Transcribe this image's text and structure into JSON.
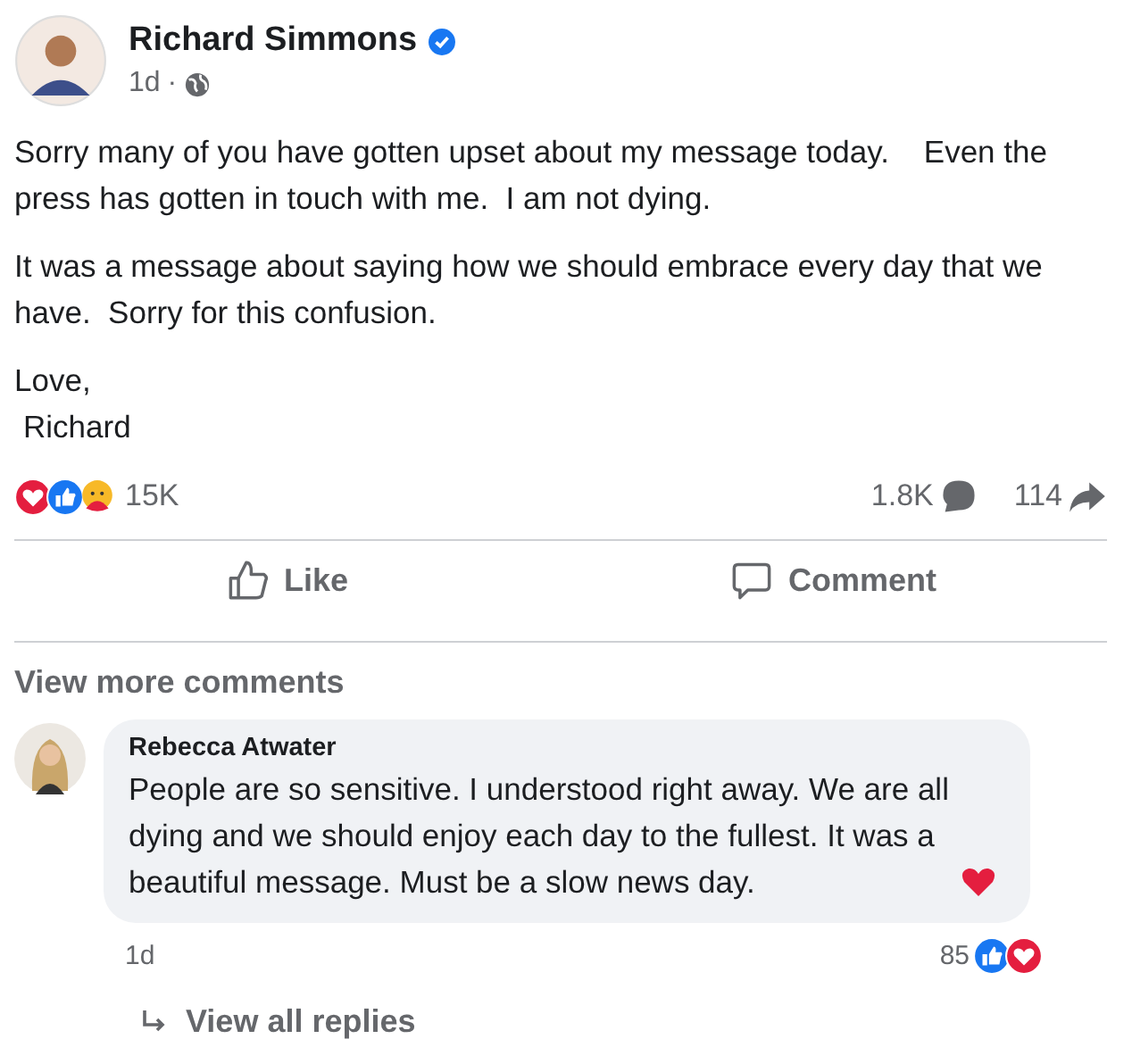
{
  "post": {
    "author": "Richard Simmons",
    "verified": true,
    "time": "1d",
    "separator": "·",
    "paragraphs": [
      "Sorry many of you have gotten upset about my message today.    Even the press has gotten in touch with me.  I am not dying.",
      "It was a message about saying how we should embrace every day that we have.  Sorry for this confusion."
    ],
    "signoff": [
      "Love,",
      "Richard"
    ]
  },
  "stats": {
    "reactions": "15K",
    "comments": "1.8K",
    "shares": "114"
  },
  "actions": [
    {
      "kind": "like",
      "label": "Like"
    },
    {
      "kind": "comment",
      "label": "Comment"
    }
  ],
  "view_more": "View more comments",
  "comment": {
    "author": "Rebecca Atwater",
    "text": "People are so sensitive. I understood right away. We are all dying and we should enjoy each day to the fullest. It was a beautiful message. Must be a slow news day.",
    "time": "1d",
    "reactions": "85"
  },
  "replies_link": "View all replies"
}
